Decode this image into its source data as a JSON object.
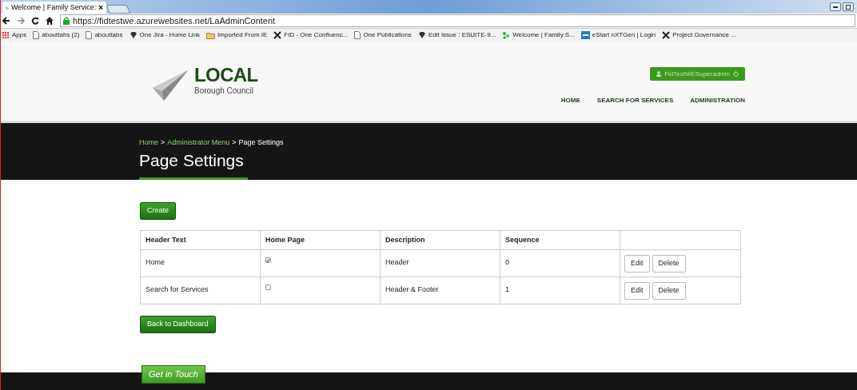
{
  "browser": {
    "tab_title": "Welcome | Family Service:",
    "tab_close": "×",
    "url": "https://fidtestwe.azurewebsites.net/LaAdminContent",
    "bookmarks": [
      {
        "label": "Apps",
        "kind": "apps"
      },
      {
        "label": "abouttabs (2)",
        "kind": "page"
      },
      {
        "label": "abouttabs",
        "kind": "page"
      },
      {
        "label": "One Jira - Home Link",
        "kind": "gem"
      },
      {
        "label": "Imported From IE",
        "kind": "folder"
      },
      {
        "label": "FID - One Confluenc...",
        "kind": "cross"
      },
      {
        "label": "One Publications",
        "kind": "page"
      },
      {
        "label": "Edit Issue : ESUITE-9...",
        "kind": "gem"
      },
      {
        "label": "Welcome | Family S...",
        "kind": "leaf"
      },
      {
        "label": "eStart nXTGen | Login",
        "kind": "tile"
      },
      {
        "label": "Project Governance ...",
        "kind": "cross"
      }
    ]
  },
  "site": {
    "logo_title": "LOCAL",
    "logo_subtitle": "Borough Council",
    "user_button": "FidTestWESuperadmin",
    "nav": [
      "HOME",
      "SEARCH FOR SERVICES",
      "ADMINISTRATION"
    ],
    "breadcrumb": [
      {
        "label": "Home",
        "current": false
      },
      {
        "label": "Administrator Menu",
        "current": false
      },
      {
        "label": "Page Settings",
        "current": true
      }
    ],
    "breadcrumb_separator": ">",
    "page_title": "Page Settings"
  },
  "create_button": "Create",
  "table": {
    "columns": [
      "Header Text",
      "Home Page",
      "Description",
      "Sequence"
    ],
    "rows": [
      {
        "header_text": "Home",
        "home_page": true,
        "description": "Header",
        "sequence": "0",
        "actions": [
          "Edit",
          "Delete"
        ]
      },
      {
        "header_text": "Search for Services",
        "home_page": false,
        "description": "Header & Footer",
        "sequence": "1",
        "actions": [
          "Edit",
          "Delete"
        ]
      }
    ]
  },
  "back_button": "Back to Dashboard",
  "footer": {
    "tab": "Get in Touch"
  }
}
